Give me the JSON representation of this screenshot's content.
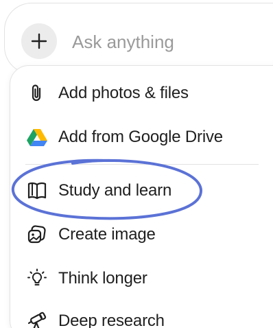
{
  "composer": {
    "placeholder": "Ask anything",
    "add_icon": "plus-icon"
  },
  "menu": {
    "items": [
      {
        "label": "Add photos & files",
        "icon": "paperclip-icon"
      },
      {
        "label": "Add from Google Drive",
        "icon": "google-drive-icon"
      },
      {
        "label": "Study and learn",
        "icon": "open-book-icon",
        "highlighted": true
      },
      {
        "label": "Create image",
        "icon": "image-icon"
      },
      {
        "label": "Think longer",
        "icon": "lightbulb-icon"
      },
      {
        "label": "Deep research",
        "icon": "telescope-icon"
      }
    ]
  },
  "colors": {
    "highlight_stroke": "#5b72d6",
    "drive_green": "#1ea362",
    "drive_yellow": "#ffba00",
    "drive_blue": "#4285f4",
    "text": "#1f1f1f",
    "placeholder": "#9a9a9a"
  }
}
